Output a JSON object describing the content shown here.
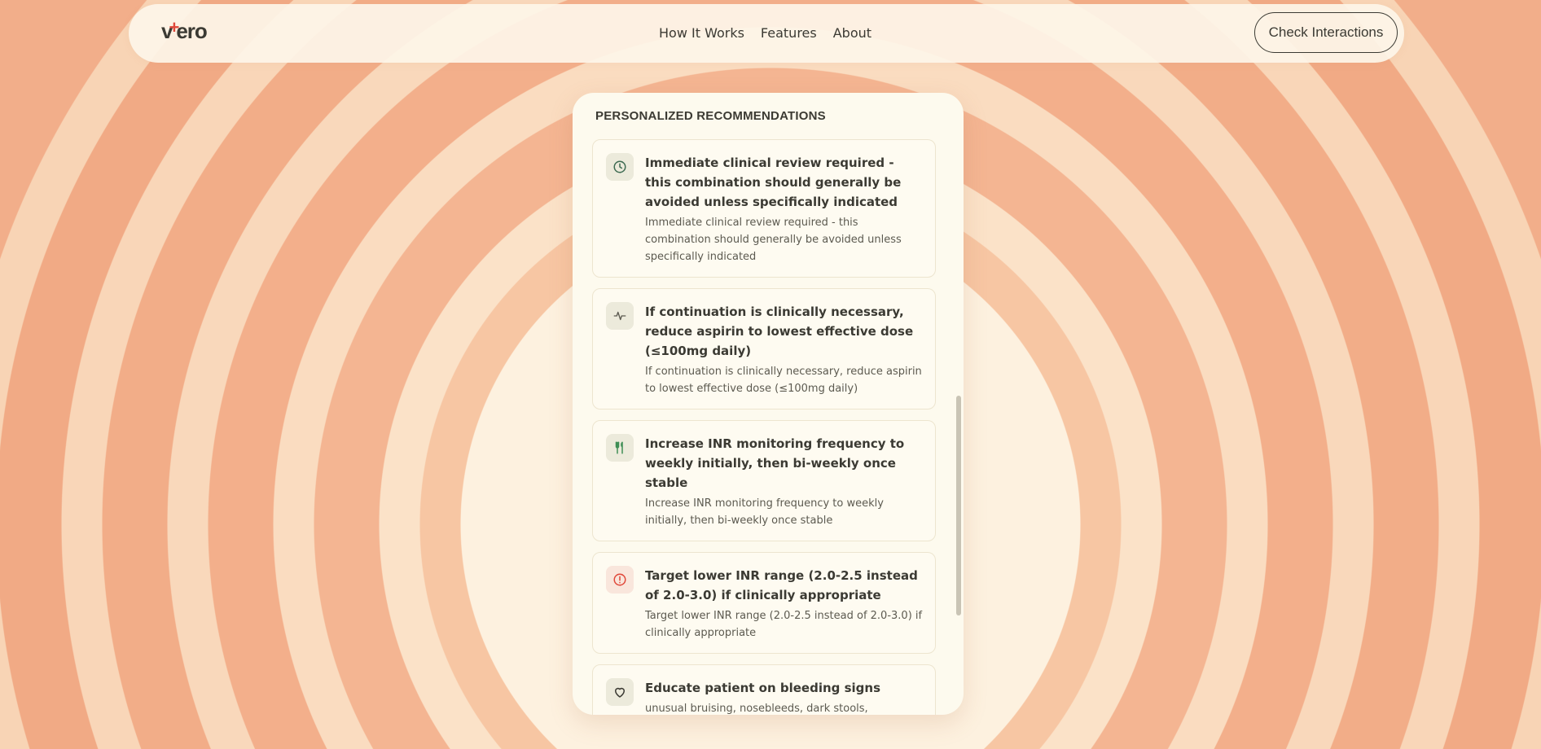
{
  "nav": {
    "logo": "vero",
    "links": [
      "How It Works",
      "Features",
      "About"
    ],
    "cta": "Check Interactions"
  },
  "panel": {
    "title": "PERSONALIZED RECOMMENDATIONS",
    "items": [
      {
        "icon": "clock-icon",
        "title": "Immediate clinical review required - this combination should generally be avoided unless specifically indicated",
        "description": "Immediate clinical review required - this combination should generally be avoided unless specifically indicated"
      },
      {
        "icon": "activity-icon",
        "title": "If continuation is clinically necessary, reduce aspirin to lowest effective dose (≤100mg daily)",
        "description": "If continuation is clinically necessary, reduce aspirin to lowest effective dose (≤100mg daily)"
      },
      {
        "icon": "utensils-icon",
        "title": "Increase INR monitoring frequency to weekly initially, then bi-weekly once stable",
        "description": "Increase INR monitoring frequency to weekly initially, then bi-weekly once stable"
      },
      {
        "icon": "alert-circle-icon",
        "title": "Target lower INR range (2.0-2.5 instead of 2.0-3.0) if clinically appropriate",
        "description": "Target lower INR range (2.0-2.5 instead of 2.0-3.0) if clinically appropriate"
      },
      {
        "icon": "heart-icon",
        "title": "Educate patient on bleeding signs",
        "description": "unusual bruising, nosebleeds, dark stools, prolonged bleeding from cuts"
      }
    ]
  },
  "colors": {
    "text": "#3b3a33",
    "accent_red": "#e0483a",
    "icon_green": "#3e8e55",
    "panel_bg": "#fdfaee"
  }
}
